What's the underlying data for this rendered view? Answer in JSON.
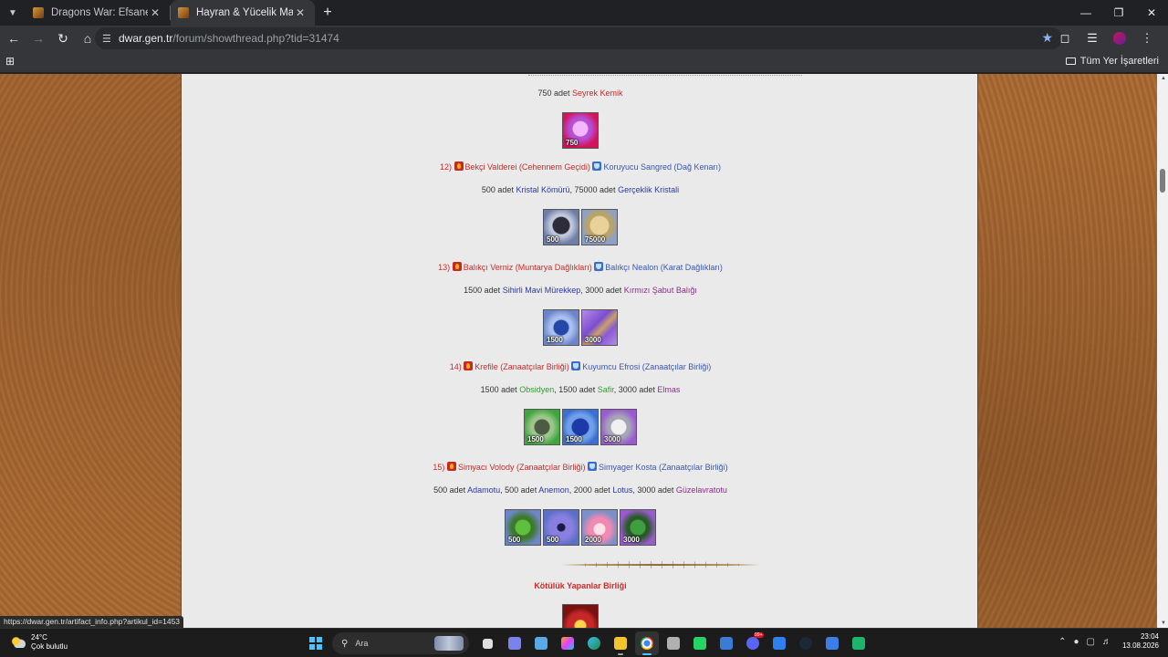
{
  "browser": {
    "tabs": [
      {
        "title": "Dragons War: Efsane Ejderhalar",
        "active": false
      },
      {
        "title": "Hayran & Yücelik Madalyonları",
        "active": true
      }
    ],
    "url_host": "dwar.gen.tr",
    "url_path": "/forum/showthread.php?tid=31474",
    "bookmarks_label": "Tüm Yer İşaretleri",
    "status_url": "https://dwar.gen.tr/artifact_info.php?artikul_id=1453"
  },
  "post": {
    "line_top": {
      "count": "750 adet",
      "item": "Seyrek Kemik"
    },
    "entry_12": {
      "number": "12)",
      "npc_red": "Bekçi Valderei (Cehennem Geçidi)",
      "npc_blue": "Koruyucu Sangred (Dağ Kenarı)",
      "req_a_count": "500 adet",
      "req_a_item": "Kristal Kömürü",
      "req_b_count": ", 75000 adet",
      "req_b_item": "Gerçeklik Kristali"
    },
    "entry_13": {
      "number": "13)",
      "npc_red": "Balıkçı Verniz (Muntarya Dağlıkları)",
      "npc_blue": "Balıkçı Nealon (Karat Dağlıkları)",
      "req_a_count": "1500 adet",
      "req_a_item": "Sihirli Mavi Mürekkep",
      "req_b_count": ", 3000 adet",
      "req_b_item": "Kırmızı Şabut Balığı"
    },
    "entry_14": {
      "number": "14)",
      "npc_red": "Krefile (Zanaatçılar Birliği)",
      "npc_blue": "Kuyumcu Efrosi (Zanaatçılar Birliği)",
      "req_a_count": "1500 adet",
      "req_a_item": "Obsidyen",
      "req_b_count": ", 1500 adet",
      "req_b_item": "Safir",
      "req_c_count": ", 3000 adet",
      "req_c_item": "Elmas"
    },
    "entry_15": {
      "number": "15)",
      "npc_red": "Simyacı Volody (Zanaatçılar Birliği)",
      "npc_blue": "Simyager Kosta (Zanaatçılar Birliği)",
      "req_a_count": "500 adet",
      "req_a_item": "Adamotu",
      "req_b_count": ", 500 adet",
      "req_b_item": "Anemon",
      "req_c_count": ", 2000 adet",
      "req_c_item": "Lotus",
      "req_d_count": ", 3000 adet",
      "req_d_item": "Güzelavratotu"
    },
    "section_title": "Kötülük Yapanlar Birliği",
    "item_quantities": {
      "seyrek_kemik": "750",
      "kristal_komuru": "500",
      "gerceklik_kristali": "75000",
      "murekkep": "1500",
      "sabut": "3000",
      "obsidyen": "1500",
      "safir": "1500",
      "elmas": "3000",
      "adamotu": "500",
      "anemon": "500",
      "lotus": "2000",
      "guzelavratotu": "3000"
    }
  },
  "taskbar": {
    "weather_temp": "24°C",
    "weather_desc": "Çok bulutlu",
    "search_placeholder": "Ara",
    "time": "23:04",
    "date": "13.08.2026",
    "notification_badge": "99+"
  }
}
